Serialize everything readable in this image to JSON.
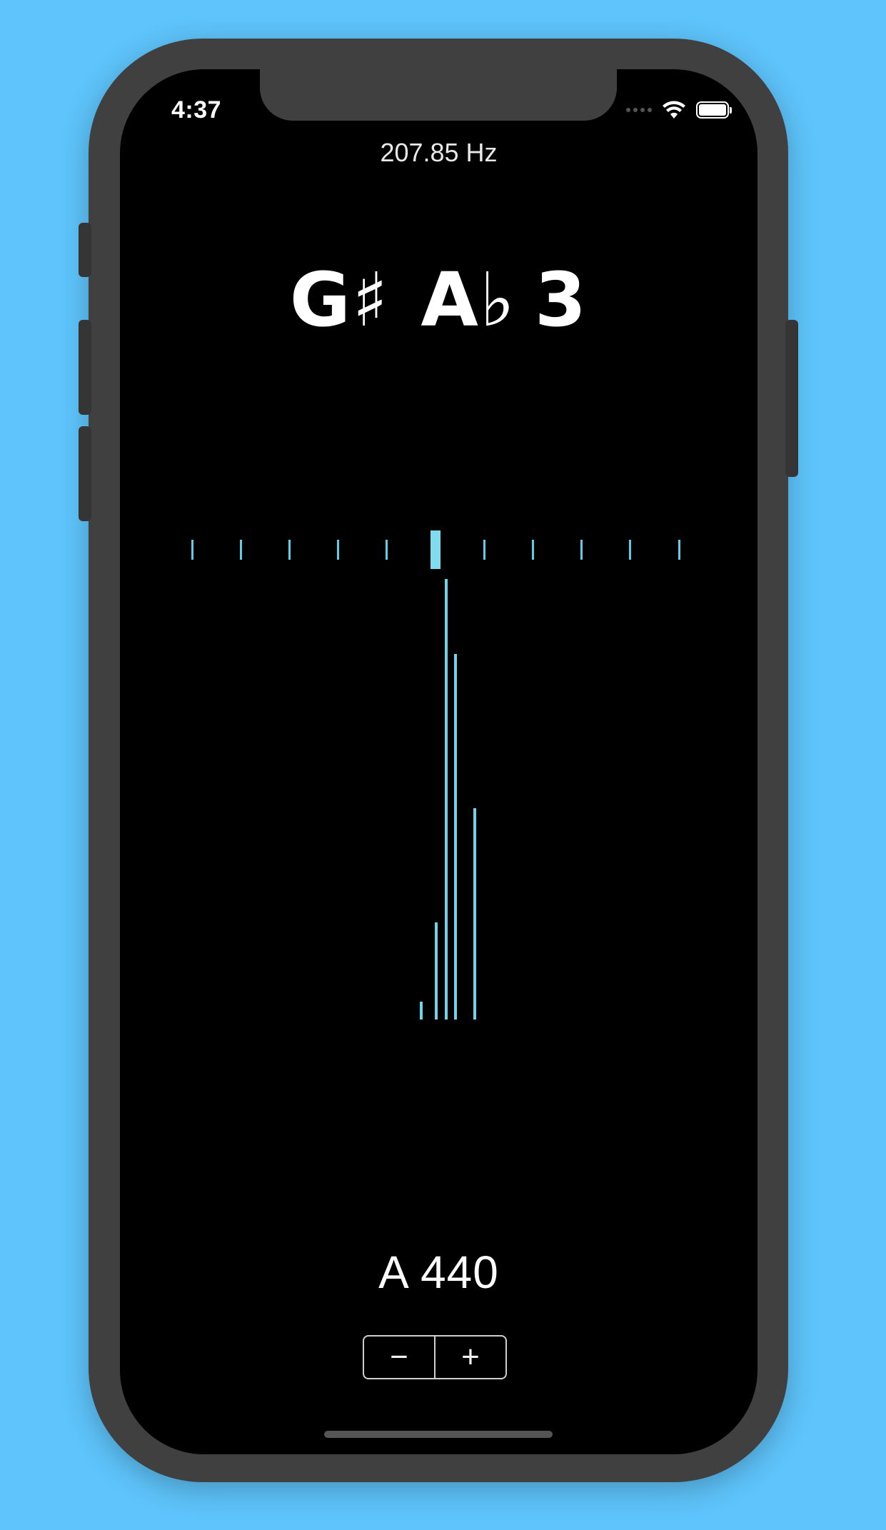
{
  "status_bar": {
    "time": "4:37",
    "icons": [
      "cellular-signal-icon",
      "wifi-icon",
      "battery-icon"
    ]
  },
  "tuner": {
    "frequency": "207.85 Hz",
    "note_sharp": "G♯",
    "note_flat": "A♭",
    "octave": "3",
    "cents_meter": {
      "tick_count": 11,
      "active_index": 5,
      "color": "#63cbe3"
    },
    "spectrum": {
      "color": "#6fd3ec",
      "bars": [
        0.04,
        0.22,
        1.0,
        0.83,
        0.48
      ]
    }
  },
  "reference": {
    "label": "A 440",
    "decrement_label": "−",
    "increment_label": "+"
  },
  "colors": {
    "background": "#5ec4fb",
    "phone_frame": "#404040",
    "screen": "#000000",
    "accent": "#63cbe3"
  }
}
